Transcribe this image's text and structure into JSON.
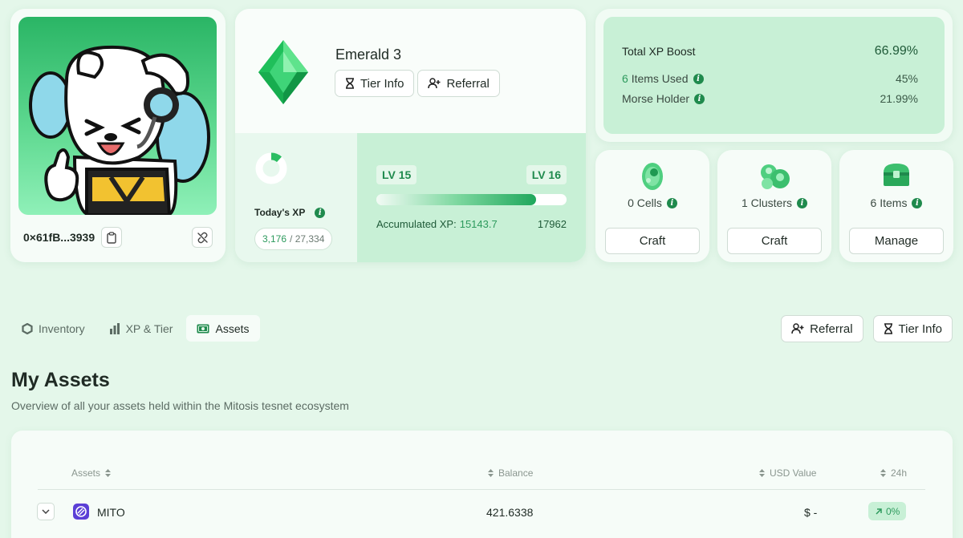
{
  "profile": {
    "wallet_address": "0×61fB...3939"
  },
  "tier": {
    "name": "Emerald 3",
    "tier_info_label": "Tier Info",
    "referral_label": "Referral",
    "today_label": "Today's XP",
    "today_xp": "3,176",
    "today_xp_max": "/ 27,334",
    "today_progress": 0.116,
    "level_current": "LV 15",
    "level_next": "LV 16",
    "level_progress": 0.84,
    "accumulated_label": "Accumulated XP:",
    "accumulated_value": "15143.7",
    "accumulated_target": "17962"
  },
  "boost": {
    "title": "Total XP Boost",
    "total": "66.99%",
    "rows": [
      {
        "count": "6",
        "label": "Items Used",
        "value": "45%"
      },
      {
        "label": "Morse Holder",
        "value": "21.99%"
      }
    ]
  },
  "cards": {
    "cells": {
      "count": "0",
      "label": "Cells",
      "button": "Craft"
    },
    "clusters": {
      "count": "1",
      "label": "Clusters",
      "button": "Craft"
    },
    "items": {
      "count": "6",
      "label": "Items",
      "button": "Manage"
    }
  },
  "tabs": [
    {
      "label": "Inventory",
      "icon": "hexagon-icon"
    },
    {
      "label": "XP & Tier",
      "icon": "bar-chart-icon"
    },
    {
      "label": "Assets",
      "icon": "money-icon",
      "active": true
    }
  ],
  "header_buttons": {
    "referral": "Referral",
    "tier_info": "Tier Info"
  },
  "page": {
    "title": "My Assets",
    "subtitle": "Overview of all your assets held within the Mitosis tesnet ecosystem"
  },
  "table": {
    "columns": [
      "Assets",
      "Balance",
      "USD Value",
      "24h"
    ],
    "rows": [
      {
        "asset": "MITO",
        "balance": "421.6338",
        "usd": "$ -",
        "change": "0%"
      }
    ]
  },
  "colors": {
    "accent": "#1f8a4d",
    "background": "#e4f7ea",
    "panel_green": "#c8f0d6"
  }
}
